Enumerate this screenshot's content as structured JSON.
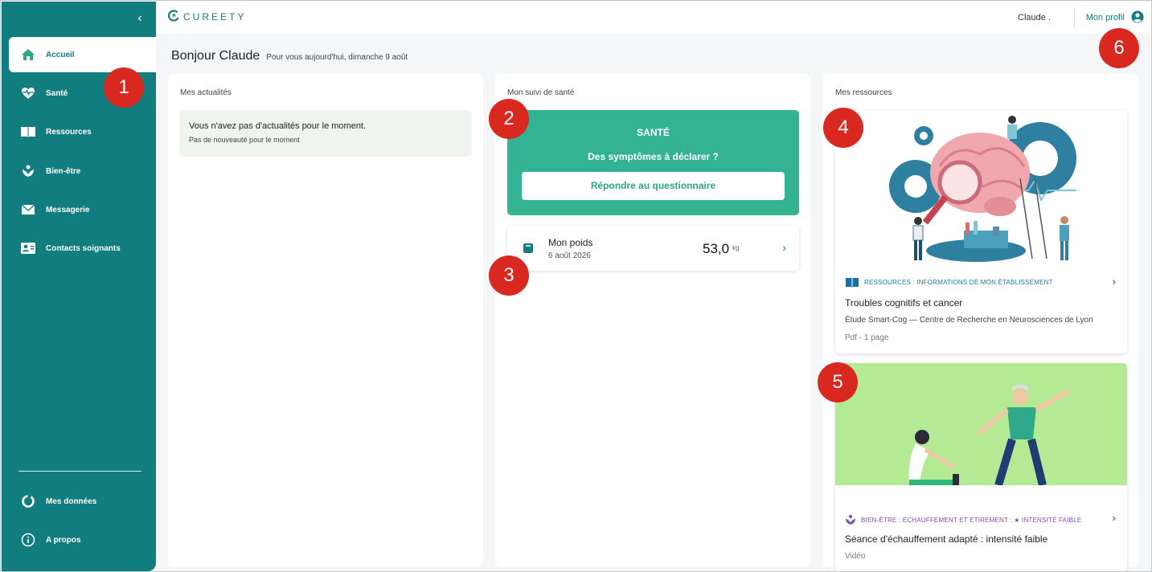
{
  "app": {
    "logo_text": "CUREETY"
  },
  "sidebar": {
    "collapse_icon": "chevron-left-icon",
    "items": [
      {
        "label": "Accueil",
        "icon": "home-icon",
        "active": true
      },
      {
        "label": "Santé",
        "icon": "heart-pulse-icon"
      },
      {
        "label": "Ressources",
        "icon": "book-icon"
      },
      {
        "label": "Bien-être",
        "icon": "wellbeing-icon"
      },
      {
        "label": "Messagerie",
        "icon": "envelope-icon"
      },
      {
        "label": "Contacts soignants",
        "icon": "contact-card-icon"
      }
    ],
    "bottom_items": [
      {
        "label": "Mes données",
        "icon": "data-ring-icon"
      },
      {
        "label": "A propos",
        "icon": "info-icon"
      }
    ]
  },
  "topbar": {
    "user_name": "Claude .",
    "profile_label": "Mon profil",
    "profile_icon": "user-circle-icon"
  },
  "greeting": {
    "title": "Bonjour Claude",
    "subtitle": "Pour vous aujourd'hui, dimanche 9 août"
  },
  "news": {
    "title": "Mes actualités",
    "empty_title": "Vous n'avez pas d'actualités pour le moment.",
    "empty_sub": "Pas de nouveauté pour le moment"
  },
  "health": {
    "title": "Mon suivi de santé",
    "card_label": "SANTÉ",
    "question": "Des symptômes à déclarer ?",
    "button": "Répondre au questionnaire",
    "weight": {
      "label": "Mon poids",
      "date": "6 août 2026",
      "value": "53,0",
      "unit": "kg"
    }
  },
  "resources": {
    "title": "Mes ressources",
    "items": [
      {
        "category": "RESSOURCES : INFORMATIONS DE MON ÉTABLISSEMENT",
        "title": "Troubles cognitifs et cancer",
        "description": "Étude Smart-Cog — Centre de Recherche en Neurosciences de Lyon",
        "meta": "Pdf - 1 page"
      },
      {
        "category": "BIEN-ÊTRE : ÉCHAUFFEMENT ET ÉTIREMENT : ★ INTENSITÉ FAIBLE",
        "title": "Séance d'échauffement adapté : intensité faible",
        "meta": "Vidéo"
      }
    ]
  },
  "markers": [
    "1",
    "2",
    "3",
    "4",
    "5",
    "6"
  ],
  "colors": {
    "sidebar": "#127d7f",
    "health_card": "#34b394",
    "marker": "#d8281f",
    "wellbeing_accent": "#7a4fb0",
    "resource_accent": "#1a7c9a"
  }
}
